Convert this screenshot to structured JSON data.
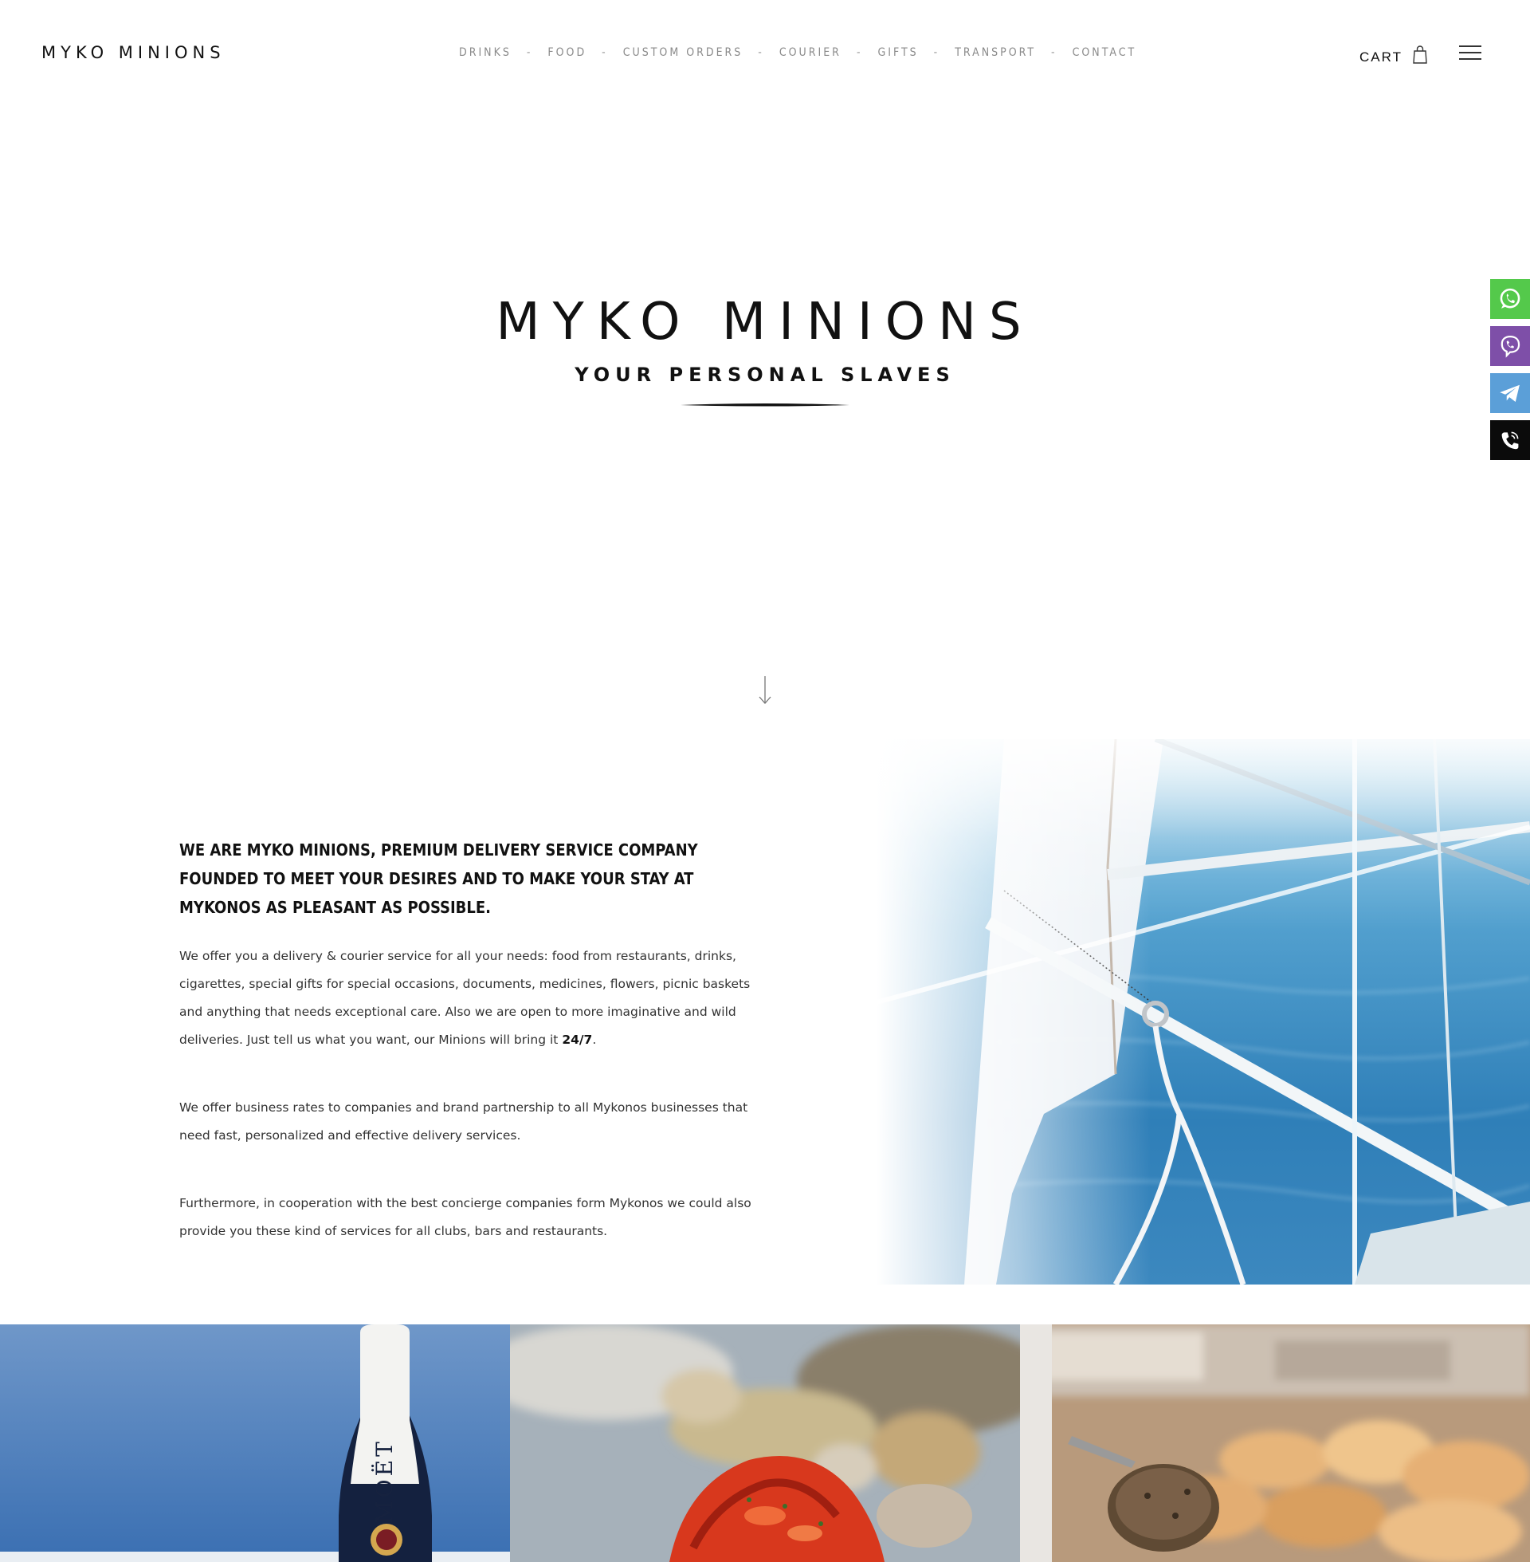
{
  "brand": {
    "logo_text": "MYKO MINIONS",
    "tagline": "YOUR PERSONAL SLAVES"
  },
  "nav": {
    "items": [
      {
        "label": "DRINKS"
      },
      {
        "label": "FOOD"
      },
      {
        "label": "CUSTOM ORDERS"
      },
      {
        "label": "COURIER"
      },
      {
        "label": "GIFTS"
      },
      {
        "label": "TRANSPORT"
      },
      {
        "label": "CONTACT"
      }
    ],
    "separator": "-"
  },
  "cart": {
    "label": "CART",
    "icon": "shopping-bag-icon"
  },
  "menu": {
    "icon": "hamburger-icon"
  },
  "contact_buttons": [
    {
      "name": "whatsapp",
      "icon": "whatsapp-icon",
      "color": "#54c94b"
    },
    {
      "name": "viber",
      "icon": "viber-icon",
      "color": "#7e4fa8"
    },
    {
      "name": "telegram",
      "icon": "telegram-icon",
      "color": "#5b9fd8"
    },
    {
      "name": "phone",
      "icon": "phone-icon",
      "color": "#0b0b0b"
    }
  ],
  "about": {
    "heading": "We are Myko Minions, premium delivery service company founded to meet your desires and to make your stay at Mykonos as pleasant as possible.",
    "p1": "We offer you a delivery & courier service for all your needs: food from restaurants, drinks, cigarettes, special gifts for special occasions, documents, medicines, flowers, picnic baskets and anything that needs exceptional care. Also we are open to more imaginative and wild deliveries. Just tell us what you want, our Minions will bring it ",
    "p1_bold": "24/7",
    "p1_end": ".",
    "p2": "We offer business rates to companies and brand partnership to all Mykonos businesses that need fast, personalized and effective delivery services.",
    "p3": "Furthermore, in cooperation with the best concierge companies form Mykonos we could also provide you these kind of services for all clubs, bars and restaurants."
  },
  "gallery": {
    "tiles": [
      {
        "subject": "champagne bottle",
        "bottle_text": "MOËT"
      },
      {
        "subject": "lobster seafood platter"
      },
      {
        "subject": "bread bakery"
      }
    ]
  }
}
